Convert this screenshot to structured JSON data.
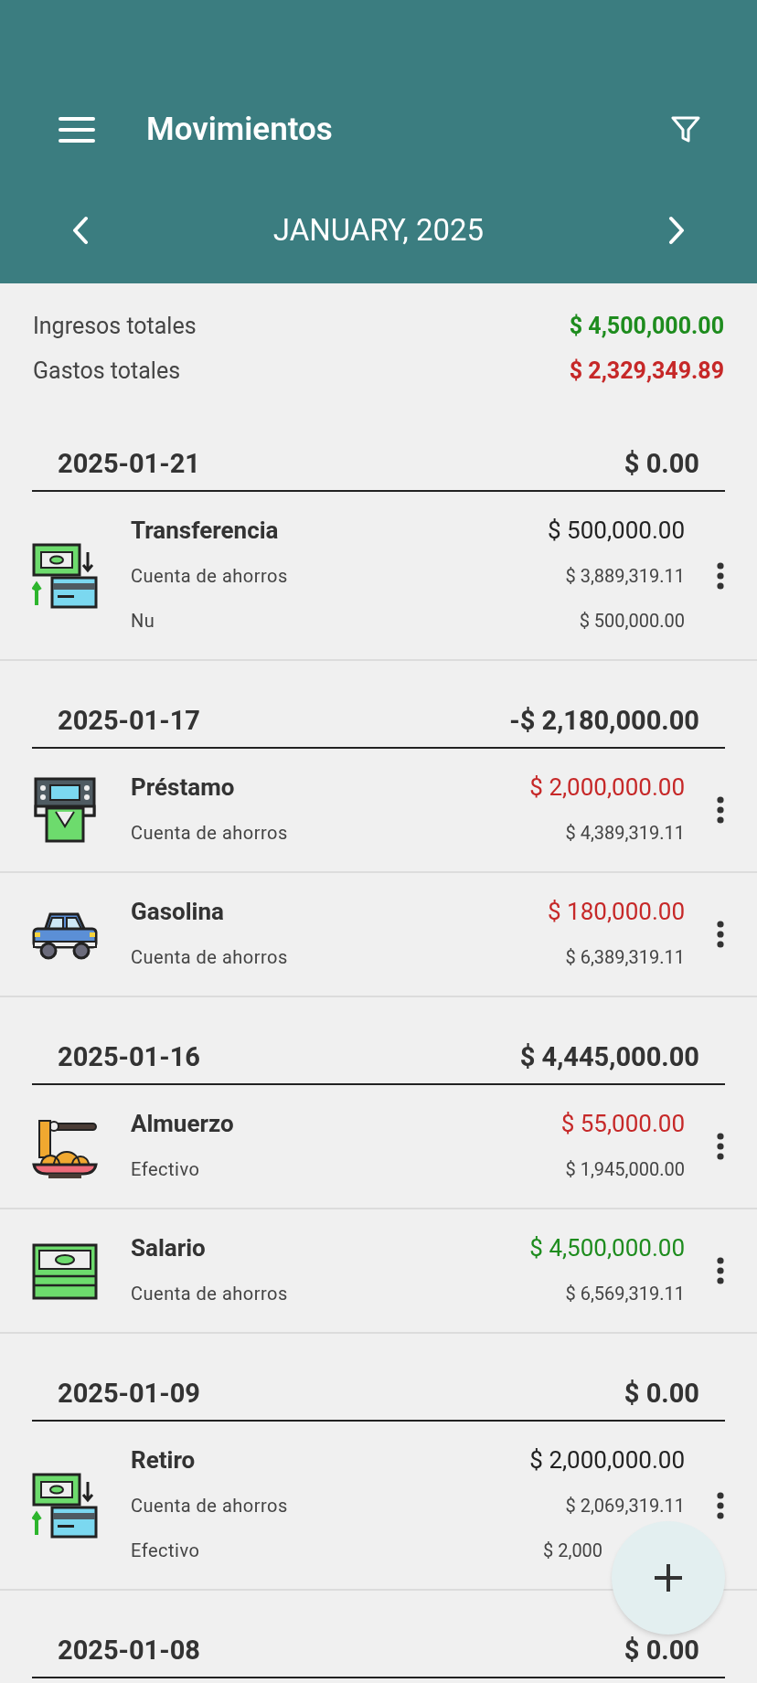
{
  "app_bar": {
    "title": "Movimientos",
    "month": "JANUARY, 2025"
  },
  "summary": [
    {
      "label": "Ingresos totales",
      "amount": "$ 4,500,000.00",
      "color": "#1e8c1e"
    },
    {
      "label": "Gastos totales",
      "amount": "$ 2,329,349.89",
      "color": "#c62828"
    }
  ],
  "groups": [
    {
      "date": "2025-01-21",
      "total": "$ 0.00",
      "items": [
        {
          "title": "Transferencia",
          "kind": "transfer",
          "amount": "$ 500,000.00",
          "color": "#222222",
          "lines": [
            {
              "account": "Cuenta de ahorros",
              "balance": "$ 3,889,319.11"
            },
            {
              "account": "Nu",
              "balance": "$ 500,000.00"
            }
          ]
        }
      ]
    },
    {
      "date": "2025-01-17",
      "total": "-$ 2,180,000.00",
      "items": [
        {
          "title": "Préstamo",
          "kind": "atm",
          "amount": "$ 2,000,000.00",
          "color": "#c62828",
          "lines": [
            {
              "account": "Cuenta de ahorros",
              "balance": "$ 4,389,319.11"
            }
          ]
        },
        {
          "title": "Gasolina",
          "kind": "car",
          "amount": "$ 180,000.00",
          "color": "#c62828",
          "lines": [
            {
              "account": "Cuenta de ahorros",
              "balance": "$ 6,389,319.11"
            }
          ]
        }
      ]
    },
    {
      "date": "2025-01-16",
      "total": "$ 4,445,000.00",
      "items": [
        {
          "title": "Almuerzo",
          "kind": "noodles",
          "amount": "$ 55,000.00",
          "color": "#c62828",
          "lines": [
            {
              "account": "Efectivo",
              "balance": "$ 1,945,000.00"
            }
          ]
        },
        {
          "title": "Salario",
          "kind": "cash",
          "amount": "$ 4,500,000.00",
          "color": "#1e8c1e",
          "lines": [
            {
              "account": "Cuenta de ahorros",
              "balance": "$ 6,569,319.11"
            }
          ]
        }
      ]
    },
    {
      "date": "2025-01-09",
      "total": "$ 0.00",
      "items": [
        {
          "title": "Retiro",
          "kind": "transfer",
          "amount": "$ 2,000,000.00",
          "color": "#222222",
          "lines": [
            {
              "account": "Cuenta de ahorros",
              "balance": "$ 2,069,319.11"
            },
            {
              "account": "Efectivo",
              "balance": "$ 2,000",
              "covered": true
            }
          ]
        }
      ]
    },
    {
      "date": "2025-01-08",
      "total": "$ 0.00"
    }
  ]
}
